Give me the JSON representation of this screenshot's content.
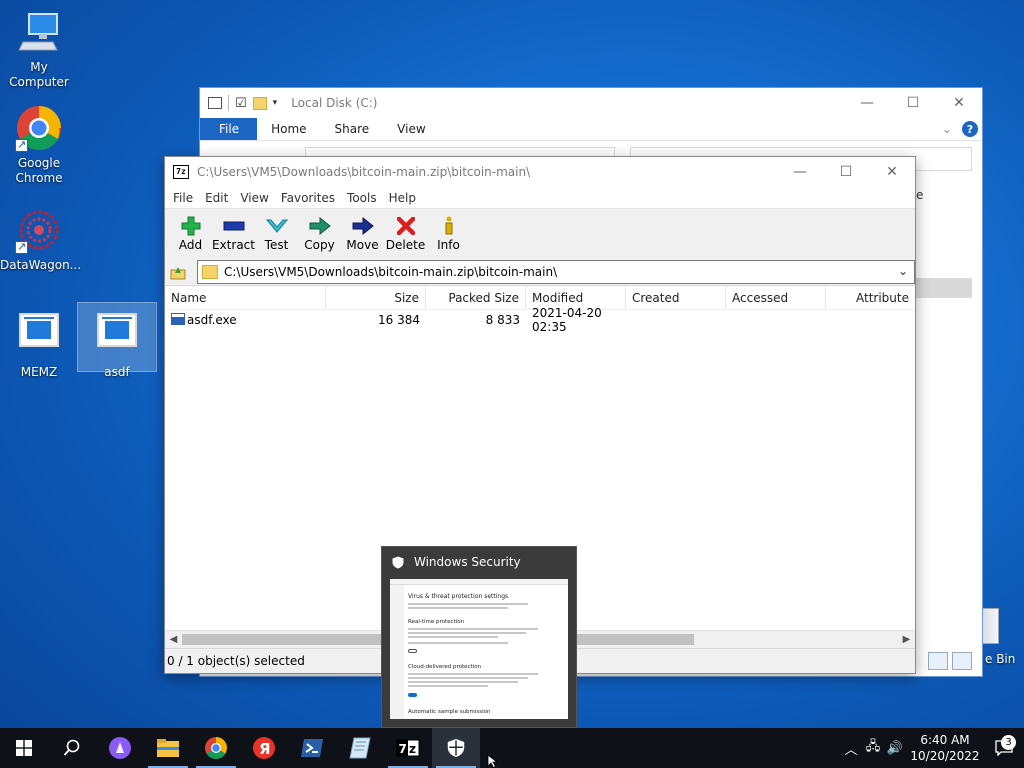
{
  "desktop": {
    "icons": [
      {
        "label": "My Computer",
        "icon": "computer-icon"
      },
      {
        "label": "Google Chrome",
        "icon": "chrome-icon"
      },
      {
        "label": "DataWagon...",
        "icon": "datawagon-icon"
      },
      {
        "label": "MEMZ",
        "icon": "app-icon"
      },
      {
        "label": "asdf",
        "icon": "app-icon"
      }
    ],
    "recycle_bin_label": "e Bin"
  },
  "explorer": {
    "title": "Local Disk (C:)",
    "ribbon_tabs": [
      "File",
      "Home",
      "Share",
      "View"
    ],
    "right_partial": "e"
  },
  "sevenzip": {
    "title": "C:\\Users\\VM5\\Downloads\\bitcoin-main.zip\\bitcoin-main\\",
    "menu": [
      "File",
      "Edit",
      "View",
      "Favorites",
      "Tools",
      "Help"
    ],
    "toolbar": [
      {
        "label": "Add",
        "icon": "add-icon",
        "color": "#22b14c"
      },
      {
        "label": "Extract",
        "icon": "extract-icon",
        "color": "#1e3aa8"
      },
      {
        "label": "Test",
        "icon": "test-icon",
        "color": "#35c0d8"
      },
      {
        "label": "Copy",
        "icon": "copy-icon",
        "color": "#1f8f6a"
      },
      {
        "label": "Move",
        "icon": "move-icon",
        "color": "#1b2f8f"
      },
      {
        "label": "Delete",
        "icon": "delete-icon",
        "color": "#d81e1e"
      },
      {
        "label": "Info",
        "icon": "info-icon",
        "color": "#d9b000"
      }
    ],
    "path": "C:\\Users\\VM5\\Downloads\\bitcoin-main.zip\\bitcoin-main\\",
    "columns": [
      "Name",
      "Size",
      "Packed Size",
      "Modified",
      "Created",
      "Accessed",
      "Attribute"
    ],
    "rows": [
      {
        "name": "asdf.exe",
        "size": "16 384",
        "packed": "8 833",
        "modified": "2021-04-20 02:35",
        "created": "",
        "accessed": "",
        "attributes": ""
      }
    ],
    "status": "0 / 1 object(s) selected"
  },
  "thumbnail": {
    "title": "Windows Security",
    "mini": {
      "heading": "Virus & threat protection settings",
      "sub1": "Real-time protection",
      "sub2": "Cloud-delivered protection",
      "sub3": "Automatic sample submission"
    }
  },
  "taskbar": {
    "apps": [
      "start",
      "search",
      "alice",
      "explorer",
      "chrome",
      "yandex",
      "powershell",
      "notepad",
      "7zip",
      "windows-security"
    ],
    "time": "6:40 AM",
    "date": "10/20/2022",
    "notifications": "3"
  }
}
